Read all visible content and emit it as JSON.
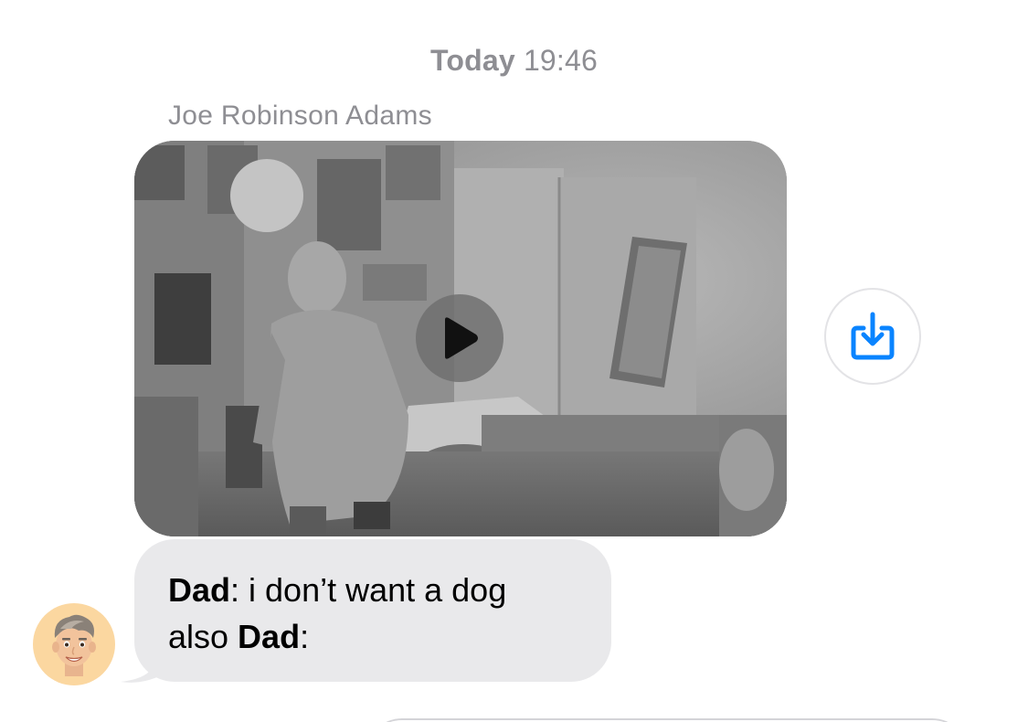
{
  "conversation": {
    "timestamp": {
      "day": "Today",
      "time": "19:46"
    },
    "messages": [
      {
        "sender": "Joe Robinson Adams",
        "type": "video",
        "play_icon": "play-icon",
        "save_icon": "save-download-icon"
      },
      {
        "type": "text",
        "line1_bold": "Dad",
        "line1_rest": ": i don’t want a dog",
        "line2_start": "also ",
        "line2_bold": "Dad",
        "line2_end": ":",
        "avatar_icon": "memoji-avatar"
      }
    ]
  },
  "colors": {
    "incoming_bubble": "#e9e9eb",
    "meta_text": "#8e8e93",
    "accent": "#0a84ff",
    "avatar_background": "#fbd7a0"
  }
}
